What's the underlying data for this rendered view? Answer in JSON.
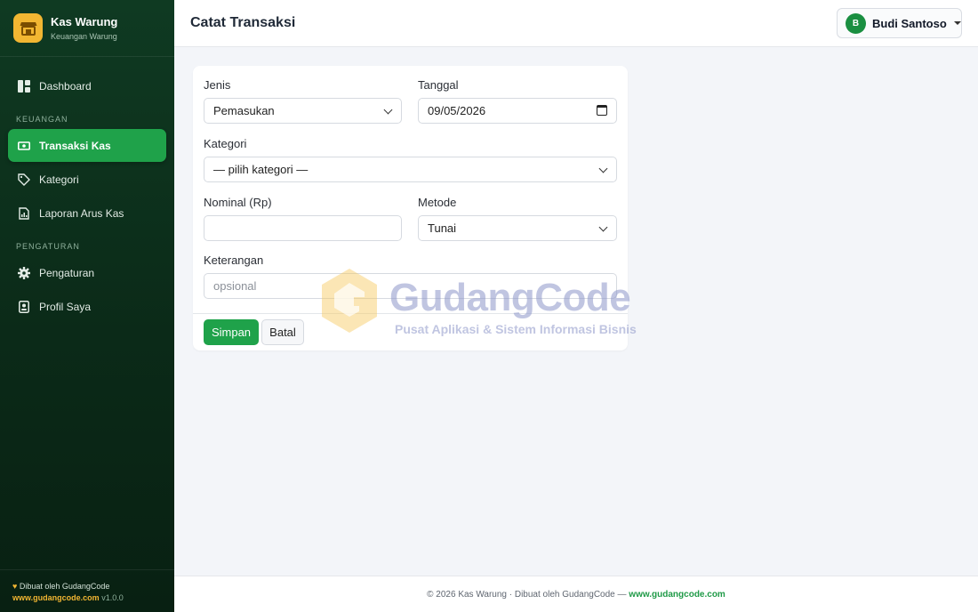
{
  "app": {
    "name": "Kas Warung",
    "subtitle": "Keuangan Warung"
  },
  "sidebar": {
    "items_top": [
      {
        "label": "Dashboard",
        "icon": "dashboard-icon"
      }
    ],
    "section_finance": "KEUANGAN",
    "finance_items": [
      {
        "label": "Transaksi Kas",
        "icon": "cash-icon",
        "active": true
      },
      {
        "label": "Kategori",
        "icon": "tag-icon"
      },
      {
        "label": "Laporan Arus Kas",
        "icon": "report-icon"
      }
    ],
    "section_settings": "PENGATURAN",
    "settings_items": [
      {
        "label": "Pengaturan",
        "icon": "gear-icon"
      },
      {
        "label": "Profil Saya",
        "icon": "profile-icon"
      }
    ],
    "footer": {
      "credit": "Dibuat oleh GudangCode",
      "site": "www.gudangcode.com",
      "version": "v1.0.0"
    }
  },
  "header": {
    "title": "Catat Transaksi",
    "user": {
      "initial": "B",
      "name": "Budi Santoso"
    }
  },
  "form": {
    "jenis_label": "Jenis",
    "jenis_value": "Pemasukan",
    "tanggal_label": "Tanggal",
    "tanggal_value": "09/05/2026",
    "kategori_label": "Kategori",
    "kategori_value": "— pilih kategori —",
    "nominal_label": "Nominal (Rp)",
    "nominal_value": "",
    "metode_label": "Metode",
    "metode_value": "Tunai",
    "keterangan_label": "Keterangan",
    "keterangan_placeholder": "opsional",
    "save_label": "Simpan",
    "cancel_label": "Batal"
  },
  "watermark": {
    "title": "GudangCode",
    "subtitle": "Pusat Aplikasi & Sistem Informasi Bisnis"
  },
  "footer": {
    "text": "© 2026 Kas Warung · Dibuat oleh GudangCode — ",
    "link": "www.gudangcode.com"
  },
  "colors": {
    "sidebar": "#0f3a22",
    "accent": "#1fa24a",
    "brand": "#f2b632"
  }
}
